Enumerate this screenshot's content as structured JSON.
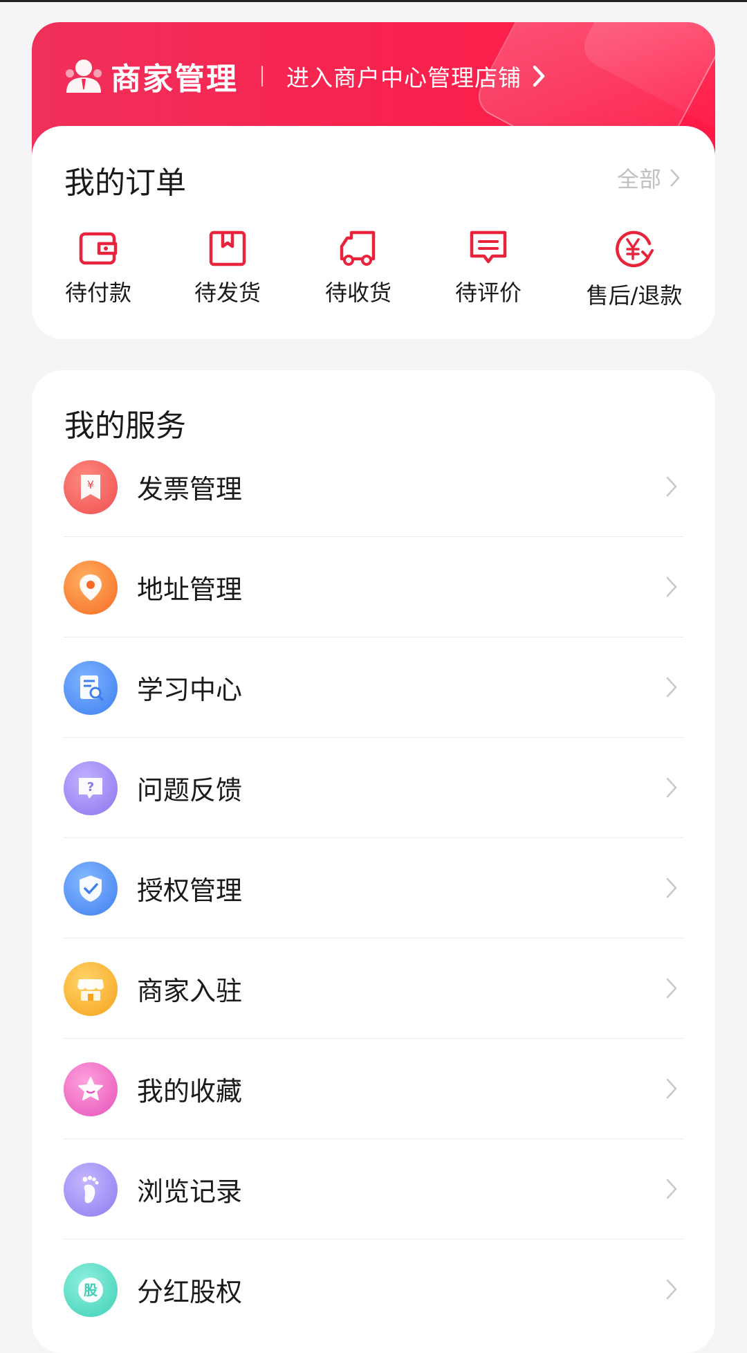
{
  "merchant": {
    "title": "商家管理",
    "link": "进入商户中心管理店铺"
  },
  "orders": {
    "title": "我的订单",
    "all_label": "全部",
    "items": [
      {
        "label": "待付款",
        "icon": "wallet-icon"
      },
      {
        "label": "待发货",
        "icon": "package-icon"
      },
      {
        "label": "待收货",
        "icon": "truck-icon"
      },
      {
        "label": "待评价",
        "icon": "comment-icon"
      },
      {
        "label": "售后/退款",
        "icon": "refund-yen-icon"
      }
    ]
  },
  "services": {
    "title": "我的服务",
    "items": [
      {
        "label": "发票管理",
        "icon": "invoice-icon",
        "color": "#f0605e"
      },
      {
        "label": "地址管理",
        "icon": "location-pin-icon",
        "color": "#f97a32"
      },
      {
        "label": "学习中心",
        "icon": "document-search-icon",
        "color": "#4b8ef5"
      },
      {
        "label": "问题反馈",
        "icon": "question-chat-icon",
        "color": "#9a82f2"
      },
      {
        "label": "授权管理",
        "icon": "shield-check-icon",
        "color": "#4c8ff5"
      },
      {
        "label": "商家入驻",
        "icon": "store-icon",
        "color": "#fbb334"
      },
      {
        "label": "我的收藏",
        "icon": "star-icon",
        "color": "#f06fc6"
      },
      {
        "label": "浏览记录",
        "icon": "footprint-icon",
        "color": "#9b8af2"
      },
      {
        "label": "分红股权",
        "icon": "equity-icon",
        "color": "#4fd6bd"
      }
    ]
  },
  "colors": {
    "accent": "#f5284f",
    "icon_red": "#e8243c"
  }
}
